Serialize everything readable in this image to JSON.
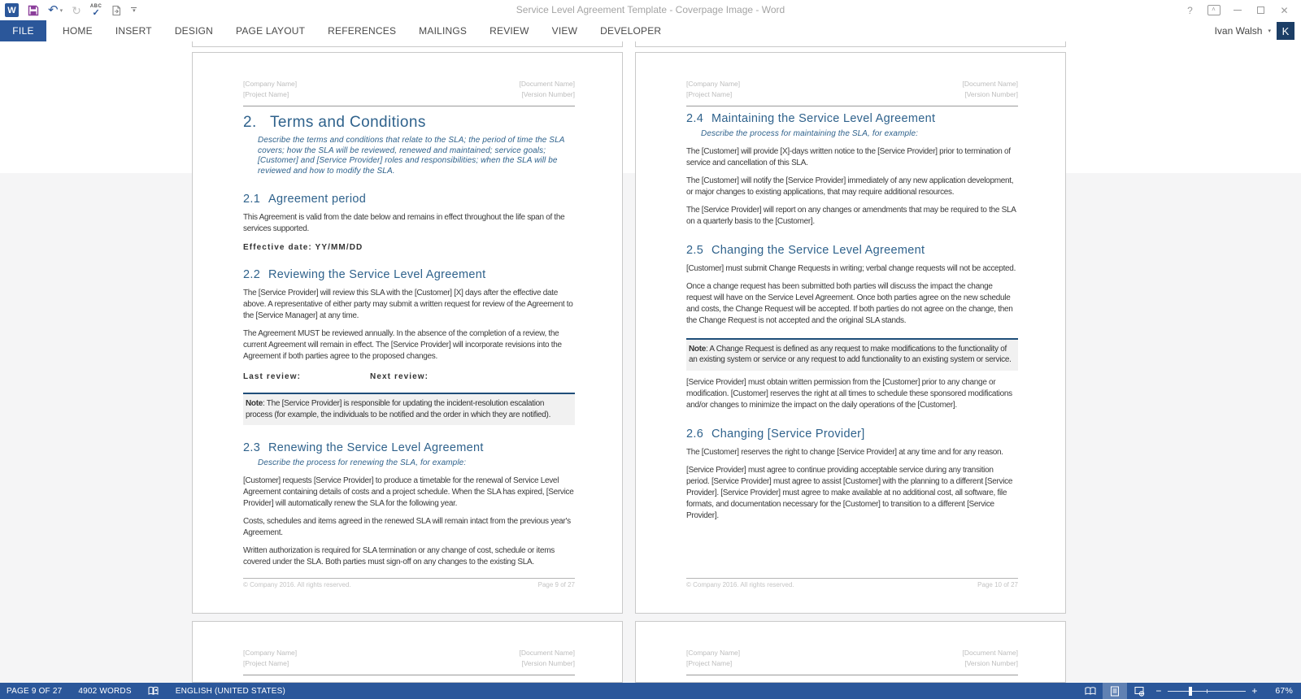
{
  "titlebar": {
    "title": "Service Level Agreement Template - Coverpage Image - Word",
    "user": "Ivan Walsh",
    "avatar_initial": "K"
  },
  "icons": {
    "word_logo": "W",
    "undo": "↶",
    "redo": "↻",
    "spell_abc": "ABC",
    "spell_check": "✓",
    "help": "?",
    "ribbon_options_arrow": "˄",
    "close": "✕",
    "caret_down": "▾",
    "zoom_minus": "−",
    "zoom_plus": "+"
  },
  "ribbon": {
    "file_label": "FILE",
    "tabs": [
      "HOME",
      "INSERT",
      "DESIGN",
      "PAGE LAYOUT",
      "REFERENCES",
      "MAILINGS",
      "REVIEW",
      "VIEW",
      "DEVELOPER"
    ]
  },
  "pages": [
    {
      "header": {
        "company": "[Company Name]",
        "project": "[Project Name]",
        "document": "[Document Name]",
        "version": "[Version Number]"
      },
      "footer": {
        "copyright": "© Company 2016. All rights reserved.",
        "page_label": "Page 9 of 27"
      },
      "blocks": [
        {
          "type": "h1",
          "num": "2.",
          "text": "Terms and Conditions"
        },
        {
          "type": "guide",
          "text": "Describe the terms and conditions that relate to the SLA; the period of time the SLA covers; how the SLA will be reviewed, renewed and maintained; service goals; [Customer] and [Service Provider] roles and responsibilities; when the SLA will be reviewed and how to modify the SLA."
        },
        {
          "type": "h2",
          "num": "2.1",
          "text": "Agreement period"
        },
        {
          "type": "p",
          "text": "This Agreement is valid from the date below and remains in effect throughout the life span of the services supported."
        },
        {
          "type": "bold",
          "text": "Effective date: YY/MM/DD"
        },
        {
          "type": "h2",
          "num": "2.2",
          "text": "Reviewing the Service Level Agreement"
        },
        {
          "type": "p",
          "text": "The [Service Provider] will review this SLA with the [Customer] [X] days after the effective date above. A representative of either party may submit a written request for review of the Agreement to the [Service Manager] at any time."
        },
        {
          "type": "p",
          "text": "The Agreement MUST be reviewed annually. In the absence of the completion of a review, the current Agreement will remain in effect. The [Service Provider] will incorporate revisions into the Agreement if both parties agree to the proposed changes."
        },
        {
          "type": "boldrow",
          "left": "Last review:",
          "right": "Next review:"
        },
        {
          "type": "note",
          "label": "Note",
          "text": ": The [Service Provider] is responsible for updating the incident-resolution escalation process (for example, the individuals to be notified and the order in which they are notified)."
        },
        {
          "type": "h2",
          "num": "2.3",
          "text": "Renewing the Service Level Agreement"
        },
        {
          "type": "guide",
          "text": "Describe the process for renewing the SLA, for example:"
        },
        {
          "type": "p",
          "text": "[Customer] requests [Service Provider] to produce a timetable for the renewal of Service Level Agreement containing details of costs and a project schedule. When the SLA has expired, [Service Provider] will automatically renew the SLA for the following year."
        },
        {
          "type": "p",
          "text": "Costs, schedules and items agreed in the renewed SLA will remain intact from the previous year's Agreement."
        },
        {
          "type": "p",
          "text": "Written authorization is required for SLA termination or any change of cost, schedule or items covered under the SLA. Both parties must sign-off on any changes to the existing SLA."
        }
      ]
    },
    {
      "header": {
        "company": "[Company Name]",
        "project": "[Project Name]",
        "document": "[Document Name]",
        "version": "[Version Number]"
      },
      "footer": {
        "copyright": "© Company 2016. All rights reserved.",
        "page_label": "Page 10 of 27"
      },
      "blocks": [
        {
          "type": "h2",
          "num": "2.4",
          "text": "Maintaining the Service Level Agreement",
          "first": true
        },
        {
          "type": "guide",
          "text": "Describe the process for maintaining the SLA, for example:"
        },
        {
          "type": "p",
          "text": "The [Customer] will provide [X]-days written notice to the [Service Provider] prior to termination of service and cancellation of this SLA."
        },
        {
          "type": "p",
          "text": "The [Customer] will notify the [Service Provider] immediately of any new application development, or major changes to existing applications, that may require additional resources."
        },
        {
          "type": "p",
          "text": "The [Service Provider] will report on any changes or amendments that may be required to the SLA on a quarterly basis to the [Customer]."
        },
        {
          "type": "h2",
          "num": "2.5",
          "text": "Changing the Service Level Agreement"
        },
        {
          "type": "p",
          "text": "[Customer] must submit Change Requests in writing; verbal change requests will not be accepted."
        },
        {
          "type": "p",
          "text": "Once a change request has been submitted both parties will discuss the impact the change request will have on the Service Level Agreement.  Once both parties agree on the new schedule and costs, the Change Request will be accepted. If both parties do not agree on the change, then the Change Request is not accepted and the original SLA stands."
        },
        {
          "type": "note",
          "label": "Note",
          "text": ": A Change Request is defined as any request to make modifications to the functionality of an existing system or service or any request to add functionality to an existing system or service."
        },
        {
          "type": "p",
          "text": "[Service Provider] must obtain written permission from the [Customer] prior to any change or modification. [Customer] reserves the right at all times to schedule these sponsored modifications and/or changes to minimize the impact on the daily operations of the [Customer]."
        },
        {
          "type": "h2",
          "num": "2.6",
          "text": "Changing [Service Provider]"
        },
        {
          "type": "p",
          "text": "The [Customer] reserves the right to change [Service Provider] at any time and for any reason."
        },
        {
          "type": "p",
          "text": "[Service Provider] must agree to continue providing acceptable service during any transition period. [Service Provider] must agree to assist [Customer] with the planning to a different [Service Provider]. [Service Provider] must agree to make available at no additional cost, all software, file formats, and documentation necessary for the [Customer] to transition to a different [Service Provider]."
        }
      ]
    },
    {
      "header": {
        "company": "[Company Name]",
        "project": "[Project Name]",
        "document": "[Document Name]",
        "version": "[Version Number]"
      }
    },
    {
      "header": {
        "company": "[Company Name]",
        "project": "[Project Name]",
        "document": "[Document Name]",
        "version": "[Version Number]"
      }
    }
  ],
  "statusbar": {
    "page": "PAGE 9 OF 27",
    "words": "4902 WORDS",
    "language": "ENGLISH (UNITED STATES)",
    "zoom": "67%"
  }
}
